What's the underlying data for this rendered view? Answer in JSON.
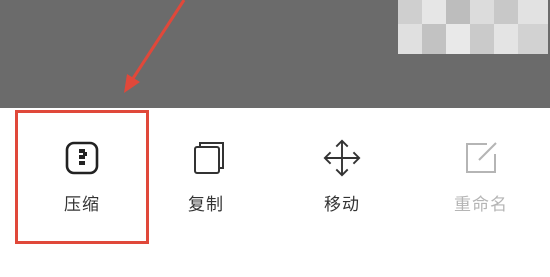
{
  "colors": {
    "overlay": "#6b6b6b",
    "highlight": "#e0483a",
    "label": "#333333",
    "disabled": "#b5b5b5"
  },
  "actions": [
    {
      "label": "压缩",
      "icon": "compress-icon",
      "enabled": true
    },
    {
      "label": "复制",
      "icon": "copy-icon",
      "enabled": true
    },
    {
      "label": "移动",
      "icon": "move-icon",
      "enabled": true
    },
    {
      "label": "重命名",
      "icon": "rename-icon",
      "enabled": false
    }
  ]
}
